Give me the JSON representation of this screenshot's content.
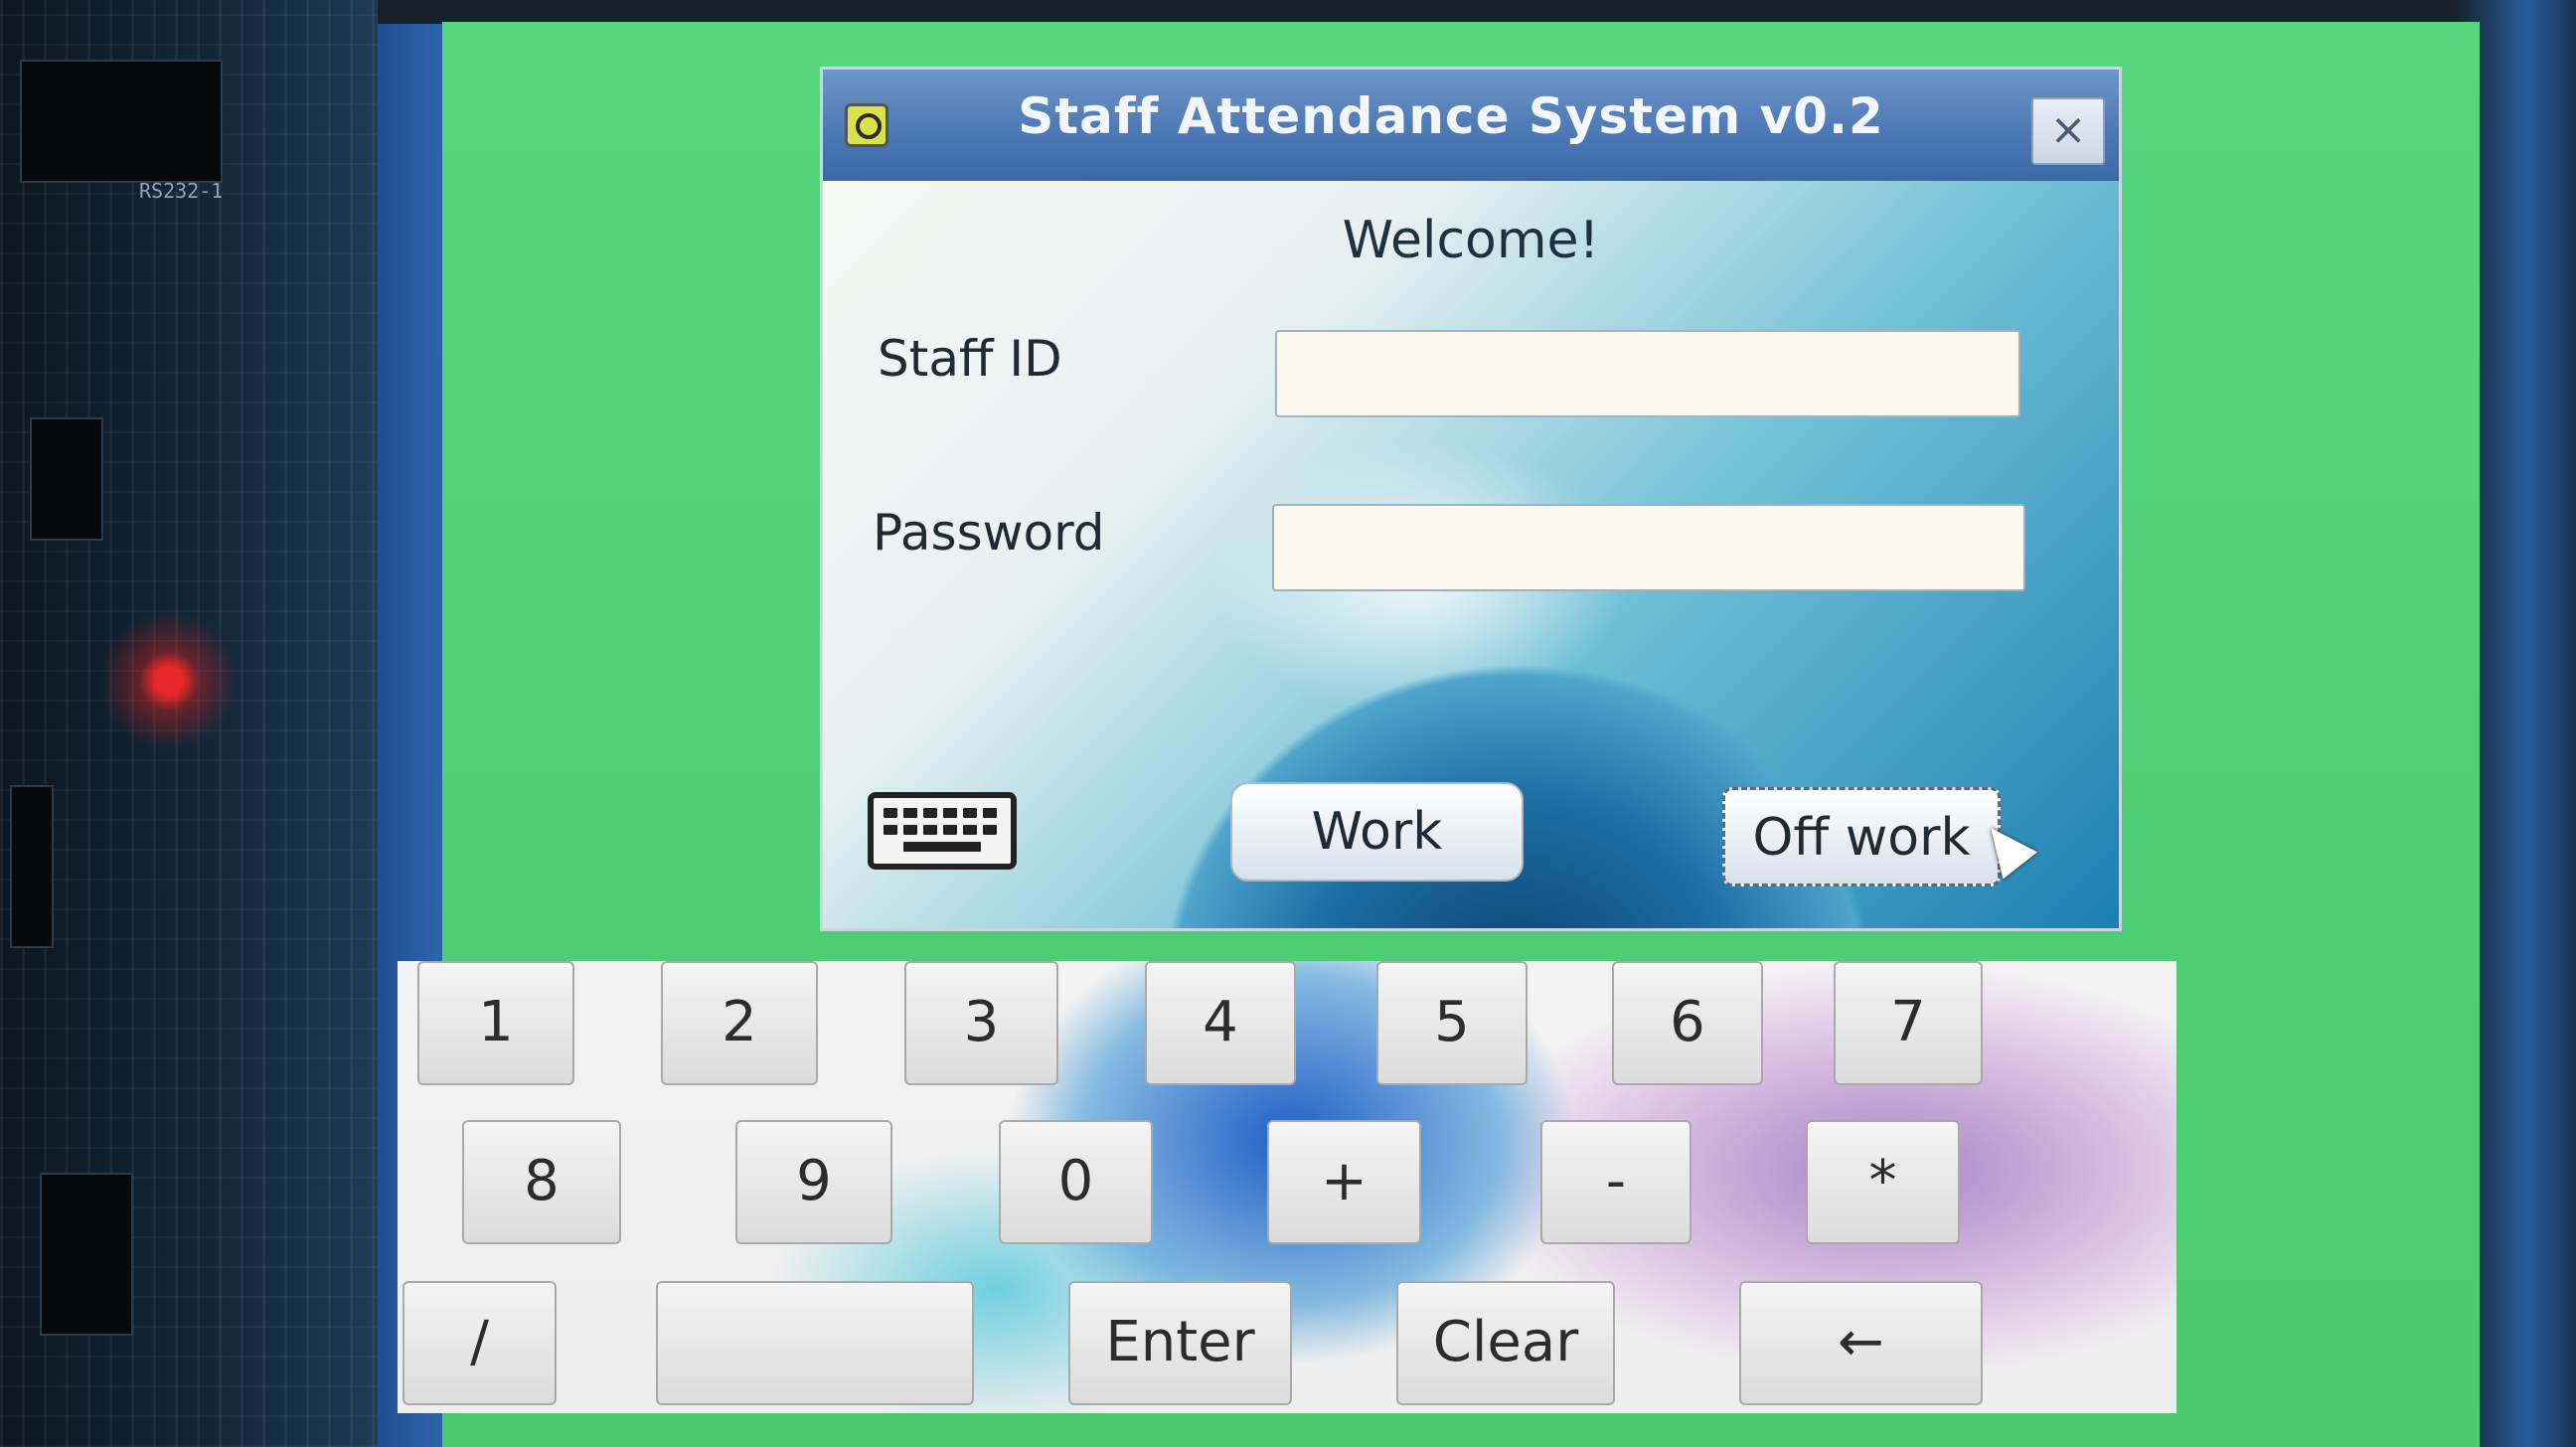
{
  "device": {
    "board_label": "RS232-1"
  },
  "window": {
    "title": "Staff Attendance System v0.2",
    "close_label": "×"
  },
  "form": {
    "welcome": "Welcome!",
    "staff_id_label": "Staff ID",
    "staff_id_value": "",
    "password_label": "Password",
    "password_value": "",
    "work_button": "Work",
    "off_work_button": "Off work"
  },
  "keypad": {
    "row1": [
      "1",
      "2",
      "3",
      "4",
      "5",
      "6",
      "7"
    ],
    "row2": [
      "8",
      "9",
      "0",
      "+",
      "-",
      "*"
    ],
    "row3": [
      "/",
      "",
      "Enter",
      "Clear",
      "←"
    ]
  },
  "icons": {
    "app": "app-logo-icon",
    "keyboard": "keyboard-icon",
    "cursor": "mouse-cursor-icon"
  },
  "colors": {
    "screen_green": "#4fcf77",
    "titlebar_blue": "#4d79b5",
    "status_led": "#ff2a2a"
  }
}
